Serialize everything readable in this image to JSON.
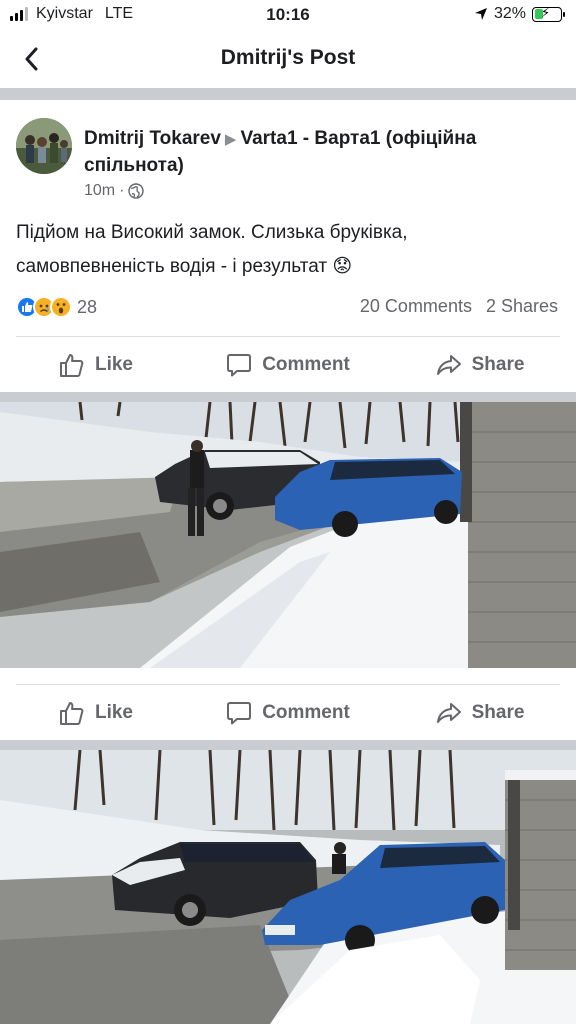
{
  "status_bar": {
    "carrier": "Kyivstar",
    "network": "LTE",
    "time": "10:16",
    "battery": "32%",
    "battery_level": 0.32
  },
  "nav": {
    "title": "Dmitrij's Post",
    "back_icon": "chevron-left-icon"
  },
  "post": {
    "author": "Dmitrij Tokarev",
    "group": "Varta1 - Варта1 (офіційна спільнота)",
    "time_ago": "10m",
    "privacy_icon": "globe-icon",
    "text_line1": "Підйом на Високий замок. Слизька бруківка,",
    "text_line2": "самовпевненість водія - і результат",
    "text_emoji": "😟",
    "reaction_count": "28",
    "comments": "20 Comments",
    "shares": "2 Shares"
  },
  "actions": {
    "like": "Like",
    "comment": "Comment",
    "share": "Share"
  },
  "colors": {
    "secondary_text": "#65676b",
    "divider_band": "#c9ccd1",
    "like_blue": "#1877f2"
  }
}
